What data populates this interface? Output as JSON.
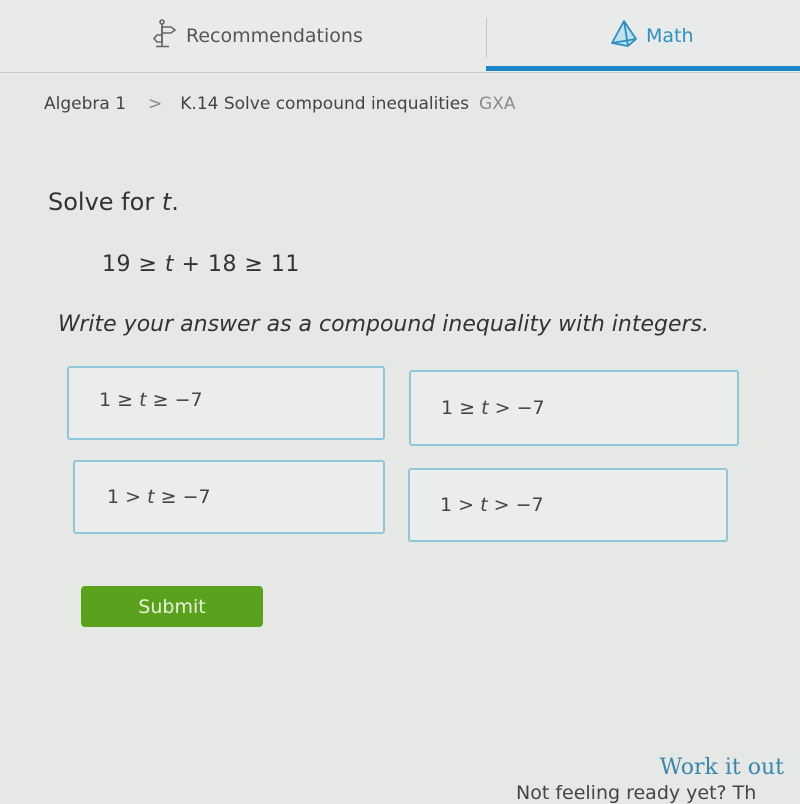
{
  "nav": {
    "tabs": [
      {
        "label": "Recommendations",
        "icon": "signpost-icon",
        "active": false
      },
      {
        "label": "Math",
        "icon": "pyramid-icon",
        "active": true
      }
    ],
    "accent_color": "#1d88c8"
  },
  "breadcrumb": {
    "course": "Algebra 1",
    "separator": ">",
    "skill": "K.14 Solve compound inequalities",
    "code": "GXA"
  },
  "question": {
    "prompt_prefix": "Solve for ",
    "variable": "t",
    "prompt_suffix": ".",
    "expression": {
      "left": "19 ≥ ",
      "var": "t",
      "right": " + 18 ≥ 11"
    },
    "instruction": "Write your answer as a compound inequality with integers."
  },
  "choices": [
    {
      "left": "1 ≥ ",
      "var": "t",
      "right": " ≥ −7"
    },
    {
      "left": "1 ≥ ",
      "var": "t",
      "right": " > −7"
    },
    {
      "left": "1 > ",
      "var": "t",
      "right": " ≥ −7"
    },
    {
      "left": "1 > ",
      "var": "t",
      "right": " > −7"
    }
  ],
  "submit_label": "Submit",
  "submit_color": "#5aa21e",
  "footer": {
    "work_it_out": "Work it out",
    "not_ready": "Not feeling ready yet? Th"
  }
}
